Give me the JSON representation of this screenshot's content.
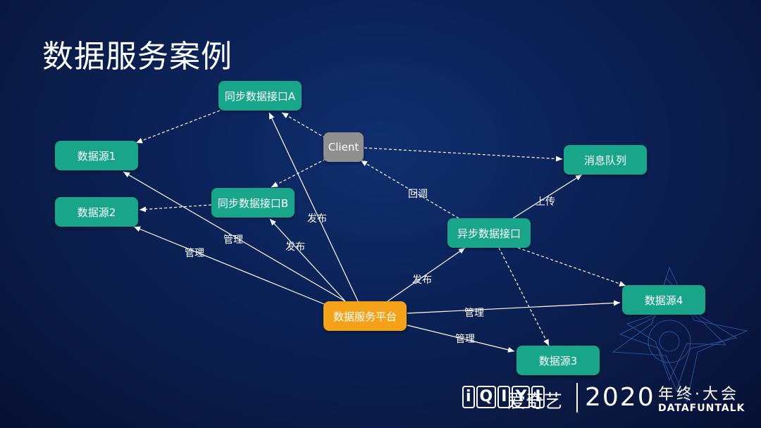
{
  "title": "数据服务案例",
  "nodes": {
    "sync_a": "同步数据接口A",
    "client": "Client",
    "msgqueue": "消息队列",
    "ds1": "数据源1",
    "ds2": "数据源2",
    "sync_b": "同步数据接口B",
    "async": "异步数据接口",
    "platform": "数据服务平台",
    "ds4": "数据源4",
    "ds3": "数据源3"
  },
  "edge_labels": {
    "callback": "回调",
    "upload": "上传",
    "publish_a": "发布",
    "manage_ds1": "管理",
    "manage_ds2": "管理",
    "publish_b": "发布",
    "publish_async": "发布",
    "manage_ds4": "管理",
    "manage_ds3": "管理"
  },
  "footer": {
    "logo_letters": [
      "i",
      "Q",
      "I",
      "Y",
      "I"
    ],
    "brand_cn": "爱奇艺",
    "year": "2020",
    "event_cn": "年终·大会",
    "event_en": "DATAFUNTALK"
  },
  "colors": {
    "node_green": "#18a58a",
    "node_grey": "#8f8f8f",
    "node_orange": "#f5a21b",
    "background": "#0b2257"
  }
}
